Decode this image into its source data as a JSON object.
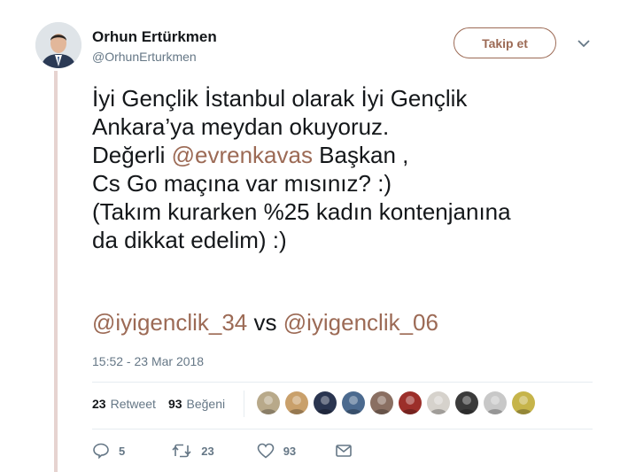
{
  "author": {
    "name": "Orhun Ertürkmen",
    "handle": "@OrhunErturkmen"
  },
  "follow_button": {
    "label": "Takip et"
  },
  "tweet": {
    "line1": "İyi Gençlik İstanbul olarak İyi Gençlik",
    "line2": "Ankara’ya meydan okuyoruz.",
    "line3_prefix": "Değerli ",
    "line3_mention": "@evrenkavas",
    "line3_suffix": " Başkan ,",
    "line4": "Cs Go maçına var mısınız? :)",
    "line5": "(Takım kurarken %25 kadın kontenjanına",
    "line6": "da dikkat edelim)  :)",
    "tag_left": "@iyigenclik_34",
    "tag_vs": " vs ",
    "tag_right": "@iyigenclik_06"
  },
  "timestamp": "15:52 - 23 Mar 2018",
  "stats": {
    "retweet_count": "23",
    "retweet_label": "Retweet",
    "like_count": "93",
    "like_label": "Beğeni"
  },
  "likers": [
    {
      "name": "liker-1",
      "color": "#b8a98a"
    },
    {
      "name": "liker-2",
      "color": "#c9a06b"
    },
    {
      "name": "liker-3",
      "color": "#2a3550"
    },
    {
      "name": "liker-4",
      "color": "#4b6a8f"
    },
    {
      "name": "liker-5",
      "color": "#8a6f62"
    },
    {
      "name": "liker-6",
      "color": "#9c2f2a"
    },
    {
      "name": "liker-7",
      "color": "#d6d2cc"
    },
    {
      "name": "liker-8",
      "color": "#3b3b3b"
    },
    {
      "name": "liker-9",
      "color": "#c8c8c8"
    },
    {
      "name": "liker-10",
      "color": "#c6b44a"
    }
  ],
  "actions": {
    "reply_count": "5",
    "retweet_count": "23",
    "like_count": "93"
  },
  "colors": {
    "accent": "#9c6a55",
    "thread_line": "#e6d3d0",
    "muted": "#657786"
  }
}
